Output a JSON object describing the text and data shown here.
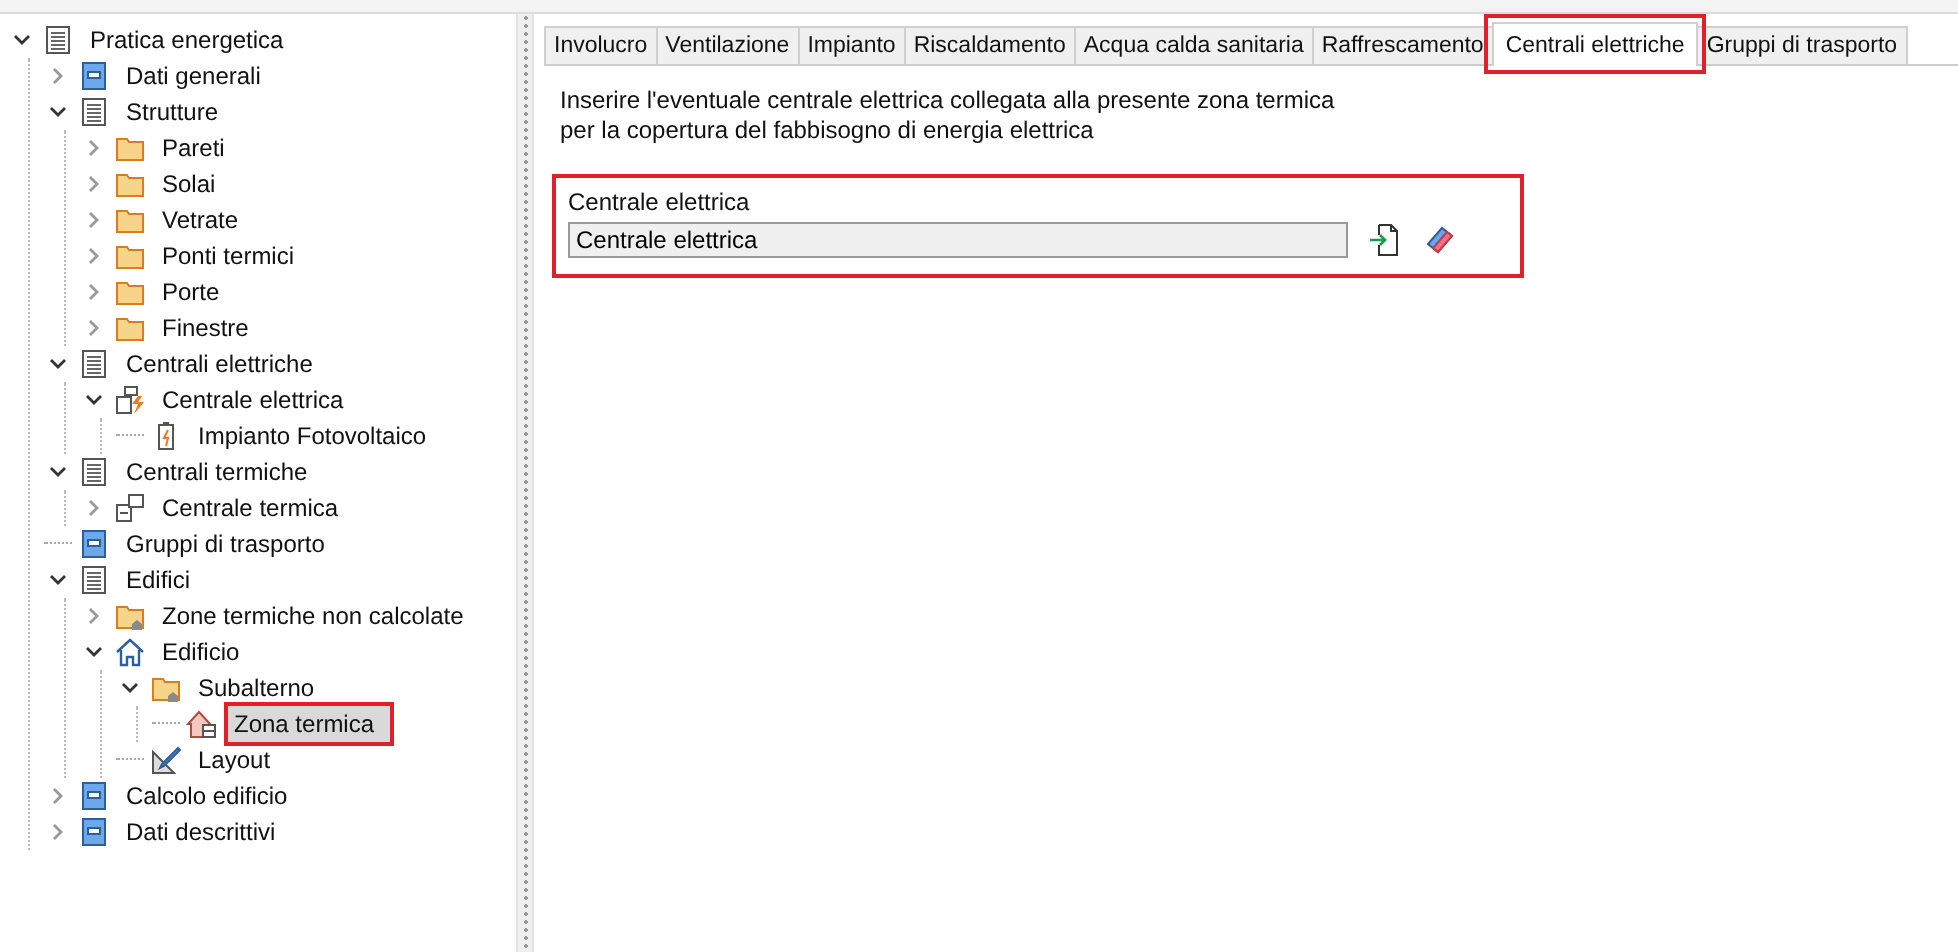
{
  "tree": [
    {
      "label": "Pratica energetica",
      "kind": "document",
      "expanded": true,
      "children": [
        {
          "label": "Dati generali",
          "kind": "form",
          "expanded": false
        },
        {
          "label": "Strutture",
          "kind": "document",
          "expanded": true,
          "children": [
            {
              "label": "Pareti",
              "kind": "folder",
              "expanded": false
            },
            {
              "label": "Solai",
              "kind": "folder",
              "expanded": false
            },
            {
              "label": "Vetrate",
              "kind": "folder",
              "expanded": false
            },
            {
              "label": "Ponti termici",
              "kind": "folder",
              "expanded": false
            },
            {
              "label": "Porte",
              "kind": "folder",
              "expanded": false
            },
            {
              "label": "Finestre",
              "kind": "folder",
              "expanded": false
            }
          ]
        },
        {
          "label": "Centrali elettriche",
          "kind": "document",
          "expanded": true,
          "children": [
            {
              "label": "Centrale elettrica",
              "kind": "electric",
              "expanded": true,
              "children": [
                {
                  "label": "Impianto Fotovoltaico",
                  "kind": "battery"
                }
              ]
            }
          ]
        },
        {
          "label": "Centrali termiche",
          "kind": "document",
          "expanded": true,
          "children": [
            {
              "label": "Centrale termica",
              "kind": "plant",
              "expanded": false
            }
          ]
        },
        {
          "label": "Gruppi di trasporto",
          "kind": "form"
        },
        {
          "label": "Edifici",
          "kind": "document",
          "expanded": true,
          "children": [
            {
              "label": "Zone termiche non calcolate",
              "kind": "folder-house",
              "expanded": false
            },
            {
              "label": "Edificio",
              "kind": "house",
              "expanded": true,
              "children": [
                {
                  "label": "Subalterno",
                  "kind": "folder-house",
                  "expanded": true,
                  "children": [
                    {
                      "label": "Zona termica",
                      "kind": "zone",
                      "selected": true,
                      "highlighted": true
                    }
                  ]
                },
                {
                  "label": "Layout",
                  "kind": "layout"
                }
              ]
            }
          ]
        },
        {
          "label": "Calcolo edificio",
          "kind": "form",
          "expanded": false
        },
        {
          "label": "Dati descrittivi",
          "kind": "form",
          "expanded": false
        }
      ]
    }
  ],
  "tabs": [
    {
      "label": "Involucro",
      "selected": false,
      "highlighted": false
    },
    {
      "label": "Ventilazione",
      "selected": false,
      "highlighted": false
    },
    {
      "label": "Impianto",
      "selected": false,
      "highlighted": false
    },
    {
      "label": "Riscaldamento",
      "selected": false,
      "highlighted": false
    },
    {
      "label": "Acqua calda sanitaria",
      "selected": false,
      "highlighted": false
    },
    {
      "label": "Raffrescamento",
      "selected": false,
      "highlighted": false
    },
    {
      "label": "Centrali elettriche",
      "selected": true,
      "highlighted": true
    },
    {
      "label": "Gruppi di trasporto",
      "selected": false,
      "highlighted": false
    }
  ],
  "description": "Inserire l'eventuale centrale elettrica collegata alla presente zona termica\nper la copertura del fabbisogno di energia elettrica",
  "field": {
    "label": "Centrale elettrica",
    "value": "Centrale elettrica",
    "highlighted": true
  }
}
